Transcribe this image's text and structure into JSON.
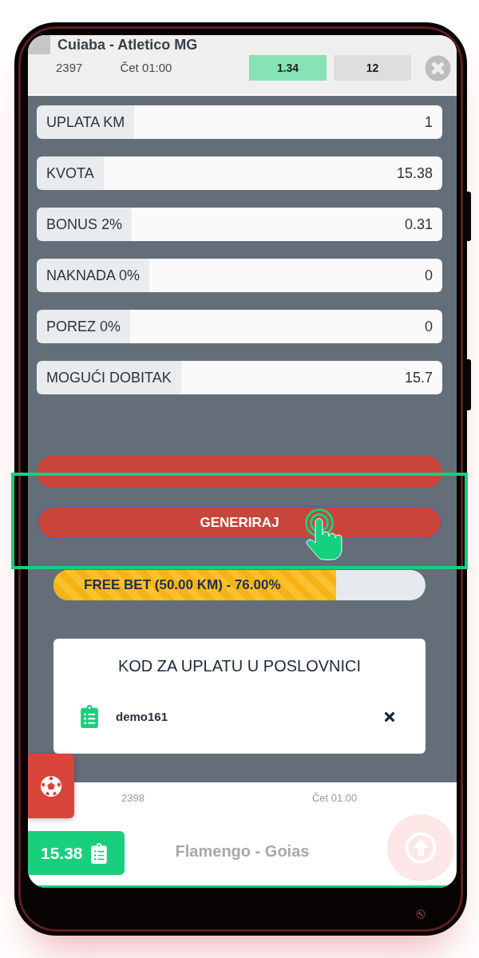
{
  "match": {
    "title": "Cuiaba - Atletico MG",
    "number": "2397",
    "time": "Čet 01:00",
    "odds": "1.34",
    "pick": "12"
  },
  "bet_form": {
    "rows": [
      {
        "label": "UPLATA KM",
        "value": "1"
      },
      {
        "label": "KVOTA",
        "value": "15.38"
      },
      {
        "label": "BONUS 2%",
        "value": "0.31"
      },
      {
        "label": "NAKNADA 0%",
        "value": "0"
      },
      {
        "label": "POREZ 0%",
        "value": "0"
      },
      {
        "label": "MOGUĆI DOBITAK",
        "value": "15.7"
      }
    ]
  },
  "actions": [
    {
      "kind": "pill",
      "focused": false
    },
    {
      "kind": "generate",
      "label": "GENERIRAJ",
      "focused": true
    }
  ],
  "tutorial": {
    "highlight": true
  },
  "free_bet": {
    "label": "FREE BET (50.00 KM) - 76.00%",
    "level": 0.76
  },
  "code_card": {
    "title": "KOD ZA UPLATU U POSLOVNICI",
    "code": "demo161"
  },
  "next_match": {
    "number": "2398",
    "time": "Čet 01:00",
    "title": "Flamengo - Goias"
  },
  "bet_slip": {
    "odds": "15.38"
  }
}
